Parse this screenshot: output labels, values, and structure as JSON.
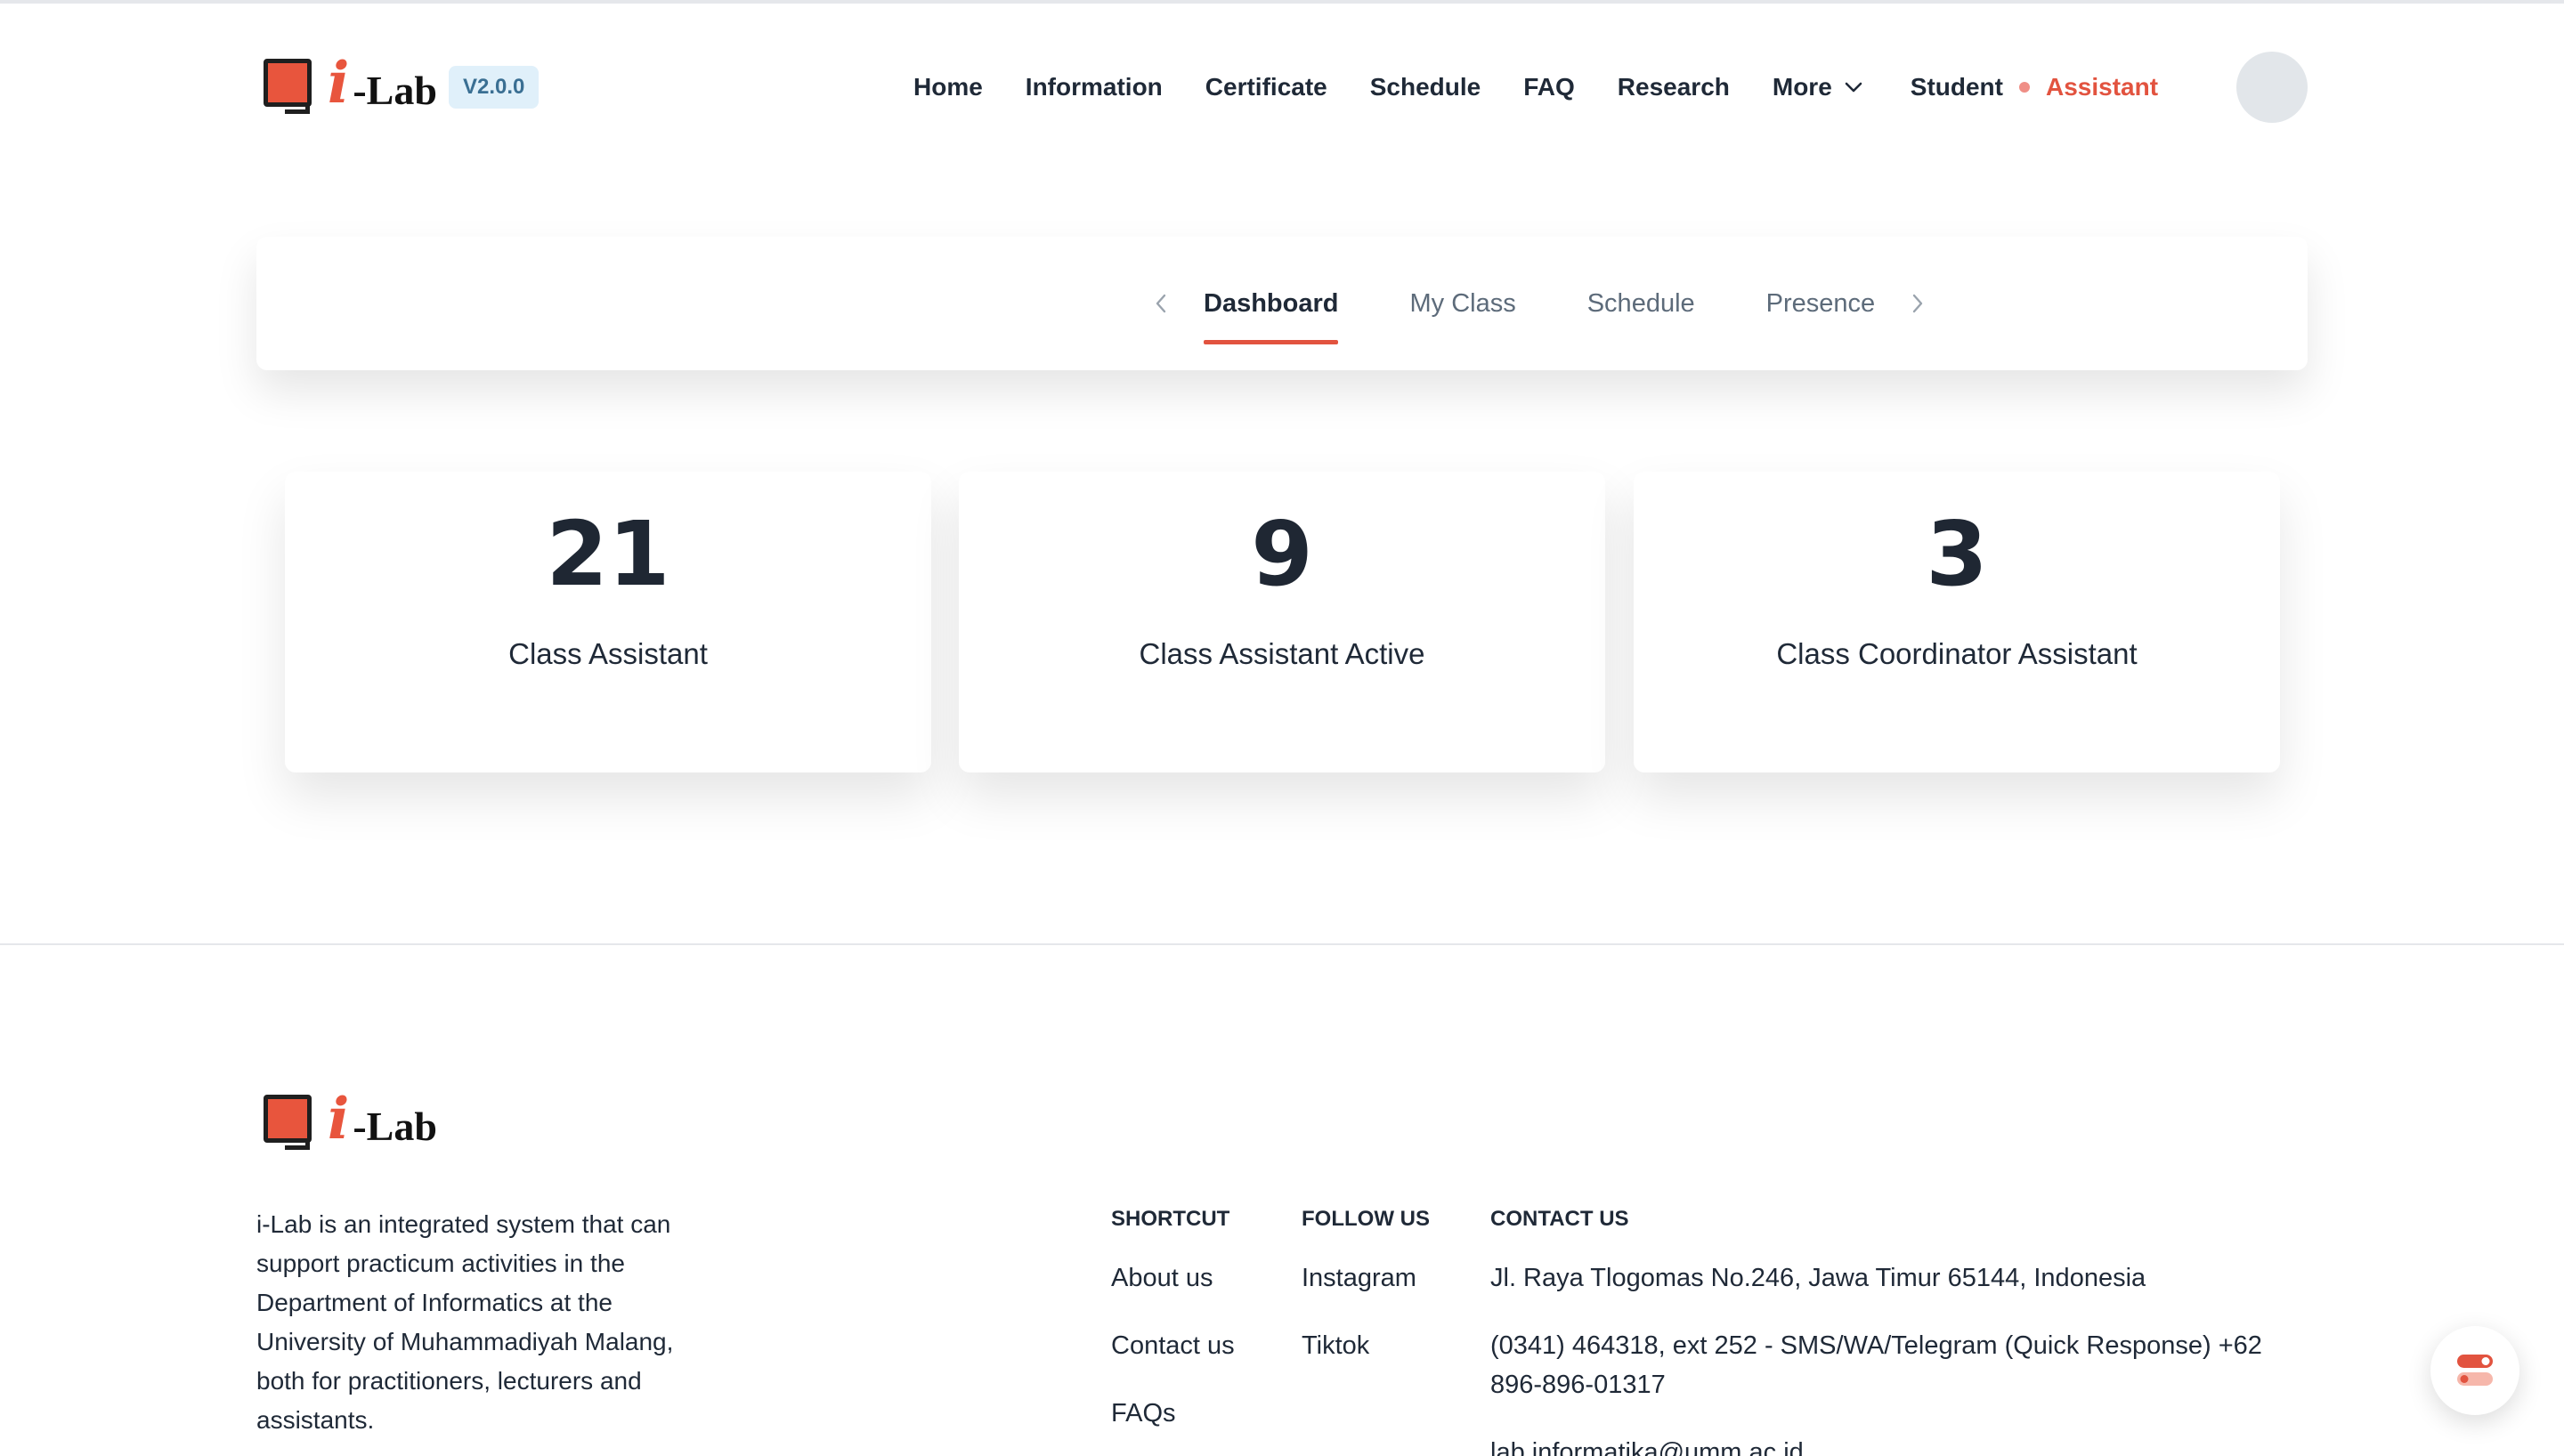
{
  "brand": {
    "name": "-Lab",
    "i_letter": "i",
    "version": "V2.0.0",
    "accent_color": "#e2533f",
    "badge_color": "#e0f0fa"
  },
  "nav": {
    "items": [
      "Home",
      "Information",
      "Certificate",
      "Schedule",
      "FAQ",
      "Research"
    ],
    "more_label": "More",
    "more_icon": "chevron-down-icon",
    "role_student": "Student",
    "role_assistant": "Assistant"
  },
  "tabs": {
    "prev_icon": "chevron-left-icon",
    "next_icon": "chevron-right-icon",
    "items": [
      "Dashboard",
      "My Class",
      "Schedule",
      "Presence"
    ],
    "active": "Dashboard"
  },
  "stats": [
    {
      "value": "21",
      "label": "Class Assistant"
    },
    {
      "value": "9",
      "label": "Class Assistant Active"
    },
    {
      "value": "3",
      "label": "Class Coordinator Assistant"
    }
  ],
  "footer": {
    "description": "i-Lab is an integrated system that can support practicum activities in the Department of Informatics at the University of Muhammadiyah Malang, both for practitioners, lecturers and assistants.",
    "shortcut": {
      "title": "SHORTCUT",
      "links": [
        "About us",
        "Contact us",
        "FAQs"
      ]
    },
    "follow": {
      "title": "FOLLOW US",
      "links": [
        "Instagram",
        "Tiktok"
      ]
    },
    "contact": {
      "title": "CONTACT US",
      "address": "Jl. Raya Tlogomas No.246, Jawa Timur 65144, Indonesia",
      "phone": "(0341) 464318, ext 252 - SMS/WA/Telegram (Quick Response) +62 896-896-01317",
      "email": "lab.informatika@umm.ac.id"
    }
  },
  "fab_icon": "toggle-icon"
}
